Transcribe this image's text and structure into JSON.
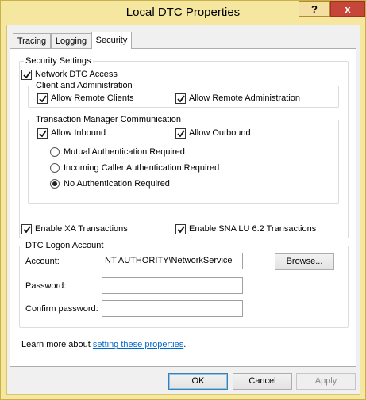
{
  "window": {
    "title": "Local DTC Properties",
    "help_label": "?",
    "close_label": "x"
  },
  "tabs": [
    {
      "label": "Tracing"
    },
    {
      "label": "Logging"
    },
    {
      "label": "Security"
    }
  ],
  "security_settings": {
    "legend": "Security Settings",
    "network_dtc_access": {
      "label": "Network DTC Access",
      "checked": true
    },
    "client_admin": {
      "legend": "Client and Administration",
      "allow_remote_clients": {
        "label": "Allow Remote Clients",
        "checked": true
      },
      "allow_remote_admin": {
        "label": "Allow Remote Administration",
        "checked": true
      }
    },
    "tm_comm": {
      "legend": "Transaction Manager Communication",
      "allow_inbound": {
        "label": "Allow Inbound",
        "checked": true
      },
      "allow_outbound": {
        "label": "Allow Outbound",
        "checked": true
      },
      "radios": [
        {
          "label": "Mutual Authentication Required",
          "selected": false
        },
        {
          "label": "Incoming Caller Authentication Required",
          "selected": false
        },
        {
          "label": "No Authentication Required",
          "selected": true
        }
      ]
    },
    "enable_xa": {
      "label": "Enable XA Transactions",
      "checked": true
    },
    "enable_sna": {
      "label": "Enable SNA LU 6.2 Transactions",
      "checked": true
    }
  },
  "logon": {
    "legend": "DTC Logon Account",
    "account_label": "Account:",
    "account_value": "NT AUTHORITY\\NetworkService",
    "browse_label": "Browse...",
    "password_label": "Password:",
    "password_value": "",
    "confirm_label": "Confirm password:",
    "confirm_value": ""
  },
  "learn_more": {
    "prefix": "Learn more about ",
    "link": "setting these properties",
    "suffix": "."
  },
  "buttons": {
    "ok": "OK",
    "cancel": "Cancel",
    "apply": "Apply"
  }
}
